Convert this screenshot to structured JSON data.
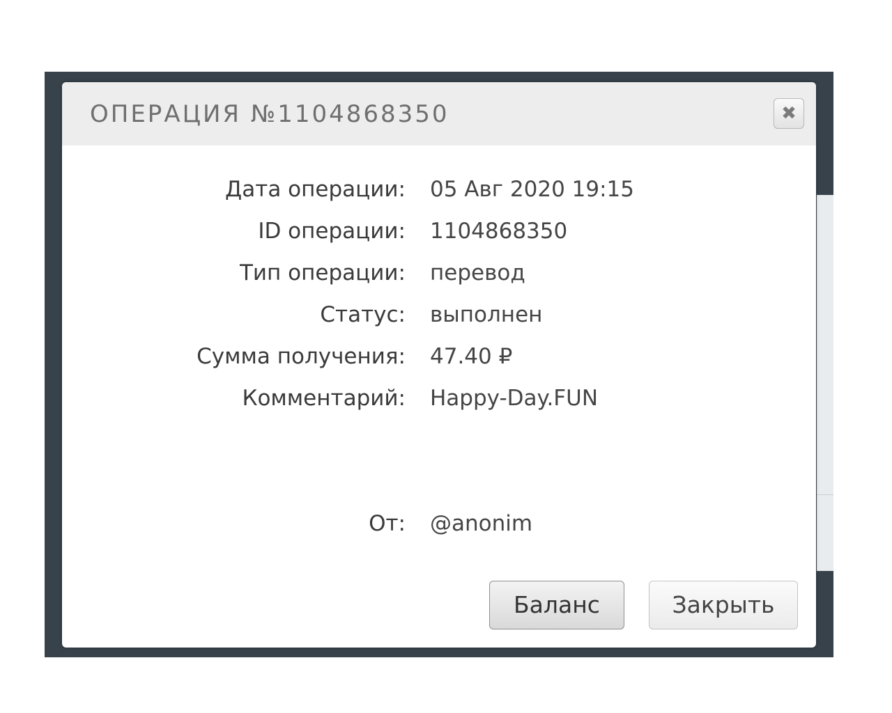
{
  "modal": {
    "title": "ОПЕРАЦИЯ №1104868350",
    "close_icon": "close-icon",
    "close_glyph": "✖"
  },
  "details": [
    {
      "label": "Дата операции:",
      "value": "05 Авг 2020 19:15"
    },
    {
      "label": "ID операции:",
      "value": "1104868350"
    },
    {
      "label": "Тип операции:",
      "value": "перевод"
    },
    {
      "label": "Статус:",
      "value": "выполнен"
    },
    {
      "label": "Сумма получения:",
      "value": "47.40 ₽"
    },
    {
      "label": "Комментарий:",
      "value": "Happy-Day.FUN"
    }
  ],
  "sender": {
    "label": "От:",
    "value": "@anonim"
  },
  "buttons": {
    "balance": "Баланс",
    "close": "Закрыть"
  },
  "colors": {
    "backdrop": "#37424b",
    "header": "#ededed",
    "title_text": "#6f6f6f"
  }
}
